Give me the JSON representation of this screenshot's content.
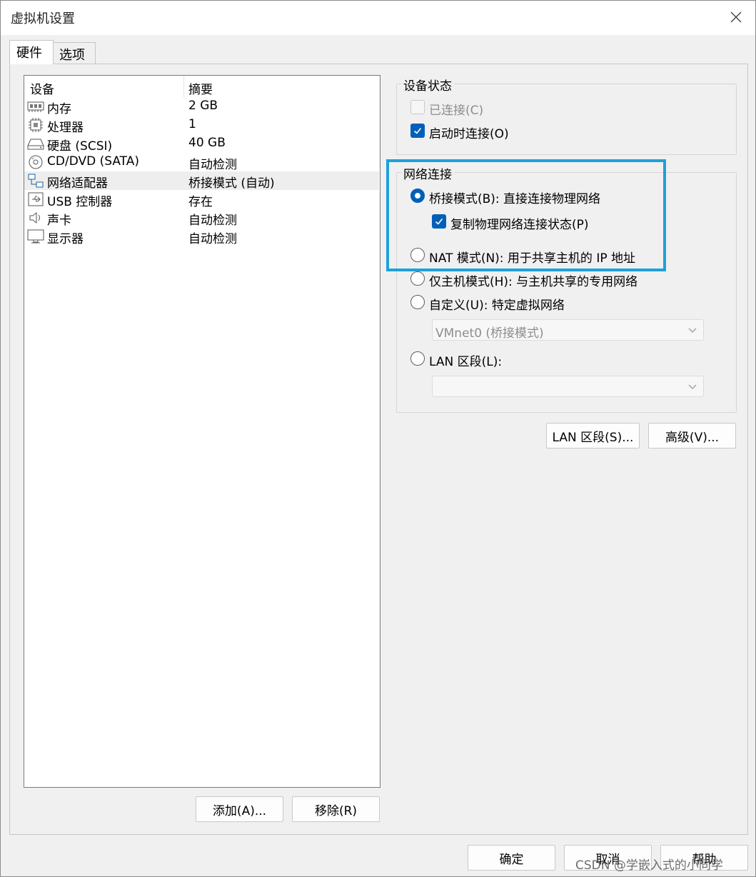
{
  "window": {
    "title": "虚拟机设置"
  },
  "tabs": [
    {
      "label": "硬件",
      "active": true
    },
    {
      "label": "选项",
      "active": false
    }
  ],
  "device_list": {
    "columns": [
      "设备",
      "摘要"
    ],
    "rows": [
      {
        "icon": "memory-icon",
        "name": "内存",
        "summary": "2 GB",
        "selected": false
      },
      {
        "icon": "cpu-icon",
        "name": "处理器",
        "summary": "1",
        "selected": false
      },
      {
        "icon": "hard-disk-icon",
        "name": "硬盘 (SCSI)",
        "summary": "40 GB",
        "selected": false
      },
      {
        "icon": "cd-dvd-icon",
        "name": "CD/DVD (SATA)",
        "summary": "自动检测",
        "selected": false
      },
      {
        "icon": "network-adapter-icon",
        "name": "网络适配器",
        "summary": "桥接模式 (自动)",
        "selected": true
      },
      {
        "icon": "usb-icon",
        "name": "USB 控制器",
        "summary": "存在",
        "selected": false
      },
      {
        "icon": "speaker-icon",
        "name": "声卡",
        "summary": "自动检测",
        "selected": false
      },
      {
        "icon": "monitor-icon",
        "name": "显示器",
        "summary": "自动检测",
        "selected": false
      }
    ]
  },
  "list_buttons": {
    "add": "添加(A)...",
    "remove": "移除(R)"
  },
  "device_status": {
    "title": "设备状态",
    "connected": {
      "label": "已连接(C)",
      "checked": false,
      "disabled": true
    },
    "connect_at_power_on": {
      "label": "启动时连接(O)",
      "checked": true
    }
  },
  "network_connection": {
    "title": "网络连接",
    "bridged": {
      "label": "桥接模式(B): 直接连接物理网络",
      "checked": true
    },
    "replicate_state": {
      "label": "复制物理网络连接状态(P)",
      "checked": true
    },
    "nat": {
      "label": "NAT 模式(N): 用于共享主机的 IP 地址",
      "checked": false
    },
    "host_only": {
      "label": "仅主机模式(H): 与主机共享的专用网络",
      "checked": false
    },
    "custom": {
      "label": "自定义(U): 特定虚拟网络",
      "checked": false
    },
    "custom_select": {
      "value": "VMnet0 (桥接模式)"
    },
    "lan_segment": {
      "label": "LAN 区段(L):",
      "checked": false
    },
    "lan_select": {
      "value": ""
    }
  },
  "right_buttons": {
    "lan_segments": "LAN 区段(S)...",
    "advanced": "高级(V)..."
  },
  "footer_buttons": {
    "ok": "确定",
    "cancel": "取消",
    "help": "帮助"
  },
  "watermark": "CSDN @学嵌入式的小同学",
  "colors": {
    "accent": "#005fb8",
    "highlight_frame": "#1fa0d8"
  }
}
